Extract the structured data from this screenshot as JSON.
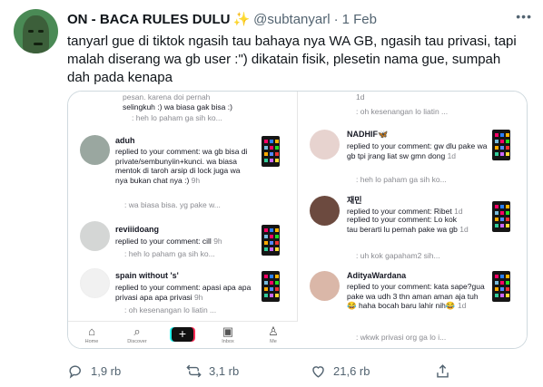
{
  "tweet": {
    "display_name": "ON - BACA RULES DULU",
    "sparkle": "✨",
    "handle": "@subtanyarl",
    "separator": "·",
    "time": "1 Feb",
    "text": "tanyarl gue di tiktok ngasih tau bahaya nya WA GB, ngasih tau privasi, tapi malah diserang wa gb user :\") dikatain fisik, plesetin nama gue, sumpah dah pada kenapa"
  },
  "media": {
    "left": {
      "cut_top_1": "pesan. karena doi pernah",
      "cut_top_2": "selingkuh :) wa biasa gak bisa :)",
      "cut_top_3": ": heh lo paham ga sih ko...",
      "c1_user": "aduh",
      "c1_text": "replied to your comment: wa gb bisa di private/sembunyiin+kunci. wa biasa mentok di taroh arsip di lock juga wa nya bukan chat nya :)",
      "c1_time": "9h",
      "c1_quote": ": wa biasa bisa. yg pake w...",
      "c2_user": "reviiidoang",
      "c2_text": "replied to your comment: cill",
      "c2_time": "9h",
      "c2_quote": ": heh lo paham ga sih ko...",
      "c3_user": "spain without 's'",
      "c3_text": "replied to your comment: apasi apa apa privasi apa apa privasi",
      "c3_time": "9h",
      "c3_quote": ": oh kesenangan lo liatin ..."
    },
    "right": {
      "cut_top_1": "1d",
      "cut_top_2": ": oh kesenangan lo liatin ...",
      "c1_user": "NADHIF🦋",
      "c1_text": "replied to your comment: gw dlu pake wa gb tpi jrang liat sw gmn dong",
      "c1_time": "1d",
      "c1_quote": ": heh lo paham ga sih ko...",
      "c2_user": "재민",
      "c2_text": "replied to your comment: Ribet",
      "c2_time": "1d",
      "c2_overlap": "replied to your comment: Lo kok",
      "c2_text2": "tau berarti lu pernah pake wa gb",
      "c2_time2": "1d",
      "c2_quote": ": uh kok gapaham2 sih...",
      "c3_user": "AdityaWardana",
      "c3_text": "replied to your comment: kata sape?gua pake wa udh 3 thn aman aman aja tuh😂 haha bocah baru lahir nih😂",
      "c3_time": "1d",
      "c3_quote": ": wkwk privasi org ga lo i..."
    },
    "nav": [
      {
        "icon": "⌂",
        "label": "Home"
      },
      {
        "icon": "⌕",
        "label": "Discover"
      },
      {
        "icon": "+",
        "label": ""
      },
      {
        "icon": "▣",
        "label": "Inbox"
      },
      {
        "icon": "♙",
        "label": "Me"
      }
    ]
  },
  "actions": {
    "replies": "1,9 rb",
    "retweets": "3,1 rb",
    "likes": "21,6 rb"
  },
  "colors": {
    "text": "#0f1419",
    "muted": "#536471",
    "border": "#cfd9de"
  }
}
